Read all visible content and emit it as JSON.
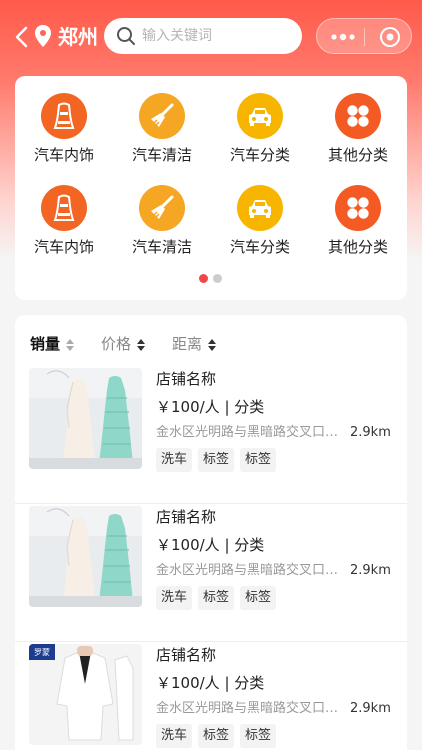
{
  "header": {
    "city": "郑州",
    "search_placeholder": "输入关键词"
  },
  "categories": [
    {
      "label": "汽车内饰",
      "icon": "car-seat-icon",
      "color": "#f26522"
    },
    {
      "label": "汽车清洁",
      "icon": "broom-icon",
      "color": "#f5a623"
    },
    {
      "label": "汽车分类",
      "icon": "car-icon",
      "color": "#f7b500"
    },
    {
      "label": "其他分类",
      "icon": "grid-icon",
      "color": "#f45a24"
    },
    {
      "label": "汽车内饰",
      "icon": "car-seat-icon",
      "color": "#f26522"
    },
    {
      "label": "汽车清洁",
      "icon": "broom-icon",
      "color": "#f5a623"
    },
    {
      "label": "汽车分类",
      "icon": "car-icon",
      "color": "#f7b500"
    },
    {
      "label": "其他分类",
      "icon": "grid-icon",
      "color": "#f45a24"
    }
  ],
  "pager": {
    "pages": 2,
    "current": 1,
    "active_color": "#f04848",
    "inactive_color": "#cccccc"
  },
  "sort": [
    {
      "label": "销量",
      "active": true
    },
    {
      "label": "价格",
      "active": false
    },
    {
      "label": "距离",
      "active": false
    }
  ],
  "shops": [
    {
      "name": "店铺名称",
      "price": "￥100/人 | 分类",
      "address": "金水区光明路与黑暗路交叉口东北角",
      "distance": "2.9km",
      "tags": [
        "洗车",
        "标签",
        "标签"
      ],
      "image": "dresses-photo"
    },
    {
      "name": "店铺名称",
      "price": "￥100/人 | 分类",
      "address": "金水区光明路与黑暗路交叉口东北角",
      "distance": "2.9km",
      "tags": [
        "洗车",
        "标签",
        "标签"
      ],
      "image": "dresses-photo"
    },
    {
      "name": "店铺名称",
      "price": "￥100/人 | 分类",
      "address": "金水区光明路与黑暗路交叉口东北角",
      "distance": "2.9km",
      "tags": [
        "洗车",
        "标签",
        "标签"
      ],
      "image": "suit-photo",
      "brand": "罗蒙"
    }
  ],
  "colors": {
    "accent": "#ff5a4a"
  }
}
